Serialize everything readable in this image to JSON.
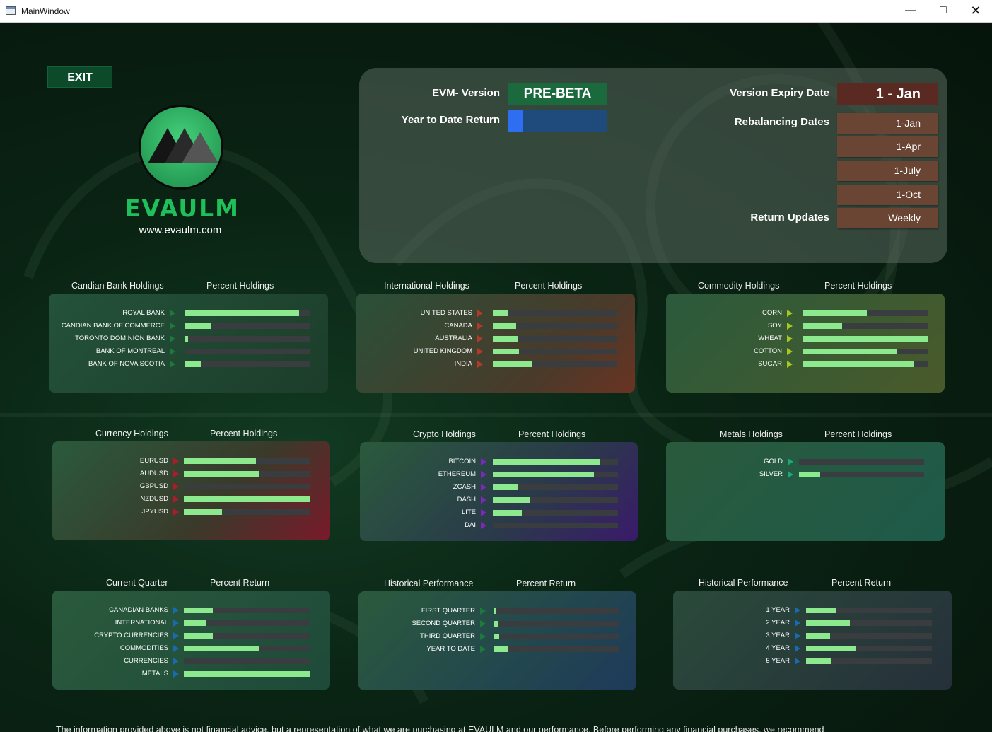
{
  "window": {
    "title": "MainWindow"
  },
  "exit_label": "EXIT",
  "brand": {
    "name": "EVAULM",
    "site": "www.evaulm.com"
  },
  "info": {
    "evm_label": "EVM- Version",
    "evm_value": "PRE-BETA",
    "ytd_label": "Year to Date Return",
    "ytd_value": 0.15,
    "expiry_label": "Version Expiry Date",
    "expiry_value": "1  - Jan",
    "rebal_label": "Rebalancing Dates",
    "rebal_dates": [
      "1-Jan",
      "1-Apr",
      "1-July",
      "1-Oct"
    ],
    "updates_label": "Return Updates",
    "updates_value": "Weekly"
  },
  "panels": [
    {
      "id": "bank",
      "title": "Candian Bank Holdings",
      "subtitle": "Percent Holdings",
      "items": [
        {
          "label": "ROYAL BANK",
          "value": 0.91
        },
        {
          "label": "CANDIAN BANK OF COMMERCE",
          "value": 0.21
        },
        {
          "label": "TORONTO DOMINION BANK",
          "value": 0.03
        },
        {
          "label": "BANK OF MONTREAL",
          "value": 0.0
        },
        {
          "label": "BANK OF NOVA SCOTIA",
          "value": 0.13
        }
      ]
    },
    {
      "id": "intl",
      "title": "International Holdings",
      "subtitle": "Percent Holdings",
      "items": [
        {
          "label": "UNITED STATES",
          "value": 0.12
        },
        {
          "label": "CANADA",
          "value": 0.19
        },
        {
          "label": "AUSTRALIA",
          "value": 0.2
        },
        {
          "label": "UNITED KINGDOM",
          "value": 0.21
        },
        {
          "label": "INDIA",
          "value": 0.31
        }
      ]
    },
    {
      "id": "comm",
      "title": "Commodity Holdings",
      "subtitle": "Percent Holdings",
      "items": [
        {
          "label": "CORN",
          "value": 0.51
        },
        {
          "label": "SOY",
          "value": 0.31
        },
        {
          "label": "WHEAT",
          "value": 1.0
        },
        {
          "label": "COTTON",
          "value": 0.75
        },
        {
          "label": "SUGAR",
          "value": 0.89
        }
      ]
    },
    {
      "id": "curr",
      "title": "Currency Holdings",
      "subtitle": "Percent Holdings",
      "items": [
        {
          "label": "EURUSD",
          "value": 0.57
        },
        {
          "label": "AUDUSD",
          "value": 0.6
        },
        {
          "label": "GBPUSD",
          "value": 0.0
        },
        {
          "label": "NZDUSD",
          "value": 1.0
        },
        {
          "label": "JPYUSD",
          "value": 0.3
        }
      ]
    },
    {
      "id": "crypto",
      "title": "Crypto Holdings",
      "subtitle": "Percent Holdings",
      "items": [
        {
          "label": "BITCOIN",
          "value": 0.86
        },
        {
          "label": "ETHEREUM",
          "value": 0.81
        },
        {
          "label": "ZCASH",
          "value": 0.2
        },
        {
          "label": "DASH",
          "value": 0.3
        },
        {
          "label": "LITE",
          "value": 0.23
        },
        {
          "label": "DAI",
          "value": 0.0
        }
      ]
    },
    {
      "id": "metals",
      "title": "Metals Holdings",
      "subtitle": "Percent Holdings",
      "items": [
        {
          "label": "GOLD",
          "value": 0.0
        },
        {
          "label": "SILVER",
          "value": 0.17
        }
      ]
    },
    {
      "id": "quarter",
      "title": "Current Quarter",
      "subtitle": "Percent Return",
      "items": [
        {
          "label": "CANADIAN BANKS",
          "value": 0.23
        },
        {
          "label": "INTERNATIONAL",
          "value": 0.18
        },
        {
          "label": "CRYPTO CURRENCIES",
          "value": 0.23
        },
        {
          "label": "COMMODITIES",
          "value": 0.59
        },
        {
          "label": "CURRENCIES",
          "value": 0.0
        },
        {
          "label": "METALS",
          "value": 1.0
        }
      ]
    },
    {
      "id": "hist1",
      "title": "Historical Performance",
      "subtitle": "Percent Return",
      "items": [
        {
          "label": "FIRST QUARTER",
          "value": 0.01
        },
        {
          "label": "SECOND QUARTER",
          "value": 0.03
        },
        {
          "label": "THIRD QUARTER",
          "value": 0.04
        },
        {
          "label": "YEAR TO DATE",
          "value": 0.11
        }
      ]
    },
    {
      "id": "hist2",
      "title": "Historical Performance",
      "subtitle": "Percent Return",
      "items": [
        {
          "label": "1 YEAR",
          "value": 0.24
        },
        {
          "label": "2 YEAR",
          "value": 0.35
        },
        {
          "label": "3 YEAR",
          "value": 0.19
        },
        {
          "label": "4 YEAR",
          "value": 0.4
        },
        {
          "label": "5 YEAR",
          "value": 0.2
        }
      ]
    }
  ],
  "disclaimer": "The information provided above is not financial advice, but a representation of what we are purchasing at EVAULM and our performance. Before performing any financial purchases, we recommend"
}
